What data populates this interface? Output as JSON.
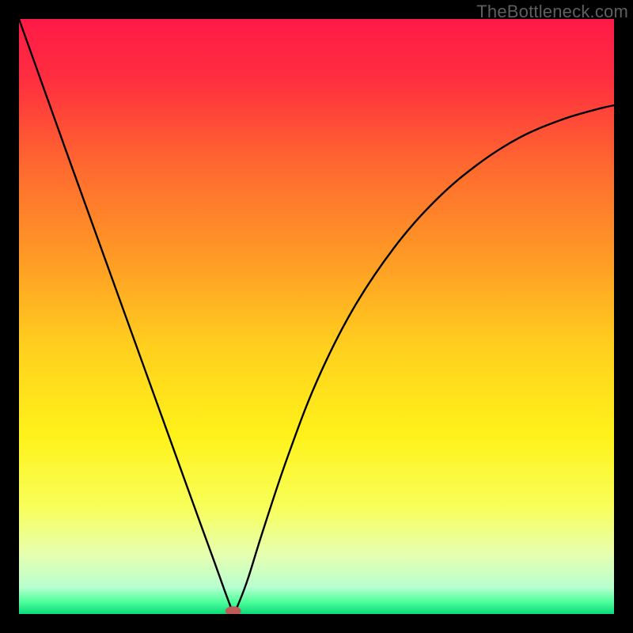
{
  "watermark": "TheBottleneck.com",
  "chart_data": {
    "type": "line",
    "title": "",
    "xlabel": "",
    "ylabel": "",
    "xlim": [
      0,
      1
    ],
    "ylim": [
      0,
      1
    ],
    "x_min_point": 0.36,
    "marker": {
      "x": 0.36,
      "y": 0.005,
      "color": "#c05a58"
    },
    "gradient_stops": [
      {
        "offset": 0.0,
        "color": "#ff1a47"
      },
      {
        "offset": 0.1,
        "color": "#ff2e3f"
      },
      {
        "offset": 0.25,
        "color": "#ff6a2f"
      },
      {
        "offset": 0.4,
        "color": "#ff9a25"
      },
      {
        "offset": 0.55,
        "color": "#ffcf1e"
      },
      {
        "offset": 0.7,
        "color": "#fff21a"
      },
      {
        "offset": 0.82,
        "color": "#f8ff5a"
      },
      {
        "offset": 0.9,
        "color": "#e6ffb0"
      },
      {
        "offset": 0.955,
        "color": "#b8ffd0"
      },
      {
        "offset": 0.98,
        "color": "#4cff9a"
      },
      {
        "offset": 1.0,
        "color": "#0cd97a"
      }
    ],
    "series": [
      {
        "name": "left-branch",
        "points": [
          {
            "x": 0.0,
            "y": 1.0
          },
          {
            "x": 0.04,
            "y": 0.888
          },
          {
            "x": 0.08,
            "y": 0.776
          },
          {
            "x": 0.12,
            "y": 0.665
          },
          {
            "x": 0.16,
            "y": 0.554
          },
          {
            "x": 0.2,
            "y": 0.443
          },
          {
            "x": 0.24,
            "y": 0.332
          },
          {
            "x": 0.28,
            "y": 0.221
          },
          {
            "x": 0.31,
            "y": 0.138
          },
          {
            "x": 0.33,
            "y": 0.083
          },
          {
            "x": 0.345,
            "y": 0.041
          },
          {
            "x": 0.355,
            "y": 0.014
          },
          {
            "x": 0.36,
            "y": 0.0
          }
        ]
      },
      {
        "name": "right-branch",
        "points": [
          {
            "x": 0.36,
            "y": 0.0
          },
          {
            "x": 0.37,
            "y": 0.02
          },
          {
            "x": 0.385,
            "y": 0.06
          },
          {
            "x": 0.41,
            "y": 0.14
          },
          {
            "x": 0.45,
            "y": 0.26
          },
          {
            "x": 0.5,
            "y": 0.39
          },
          {
            "x": 0.56,
            "y": 0.51
          },
          {
            "x": 0.63,
            "y": 0.615
          },
          {
            "x": 0.7,
            "y": 0.695
          },
          {
            "x": 0.77,
            "y": 0.755
          },
          {
            "x": 0.84,
            "y": 0.8
          },
          {
            "x": 0.91,
            "y": 0.83
          },
          {
            "x": 0.97,
            "y": 0.848
          },
          {
            "x": 1.0,
            "y": 0.855
          }
        ]
      }
    ]
  }
}
